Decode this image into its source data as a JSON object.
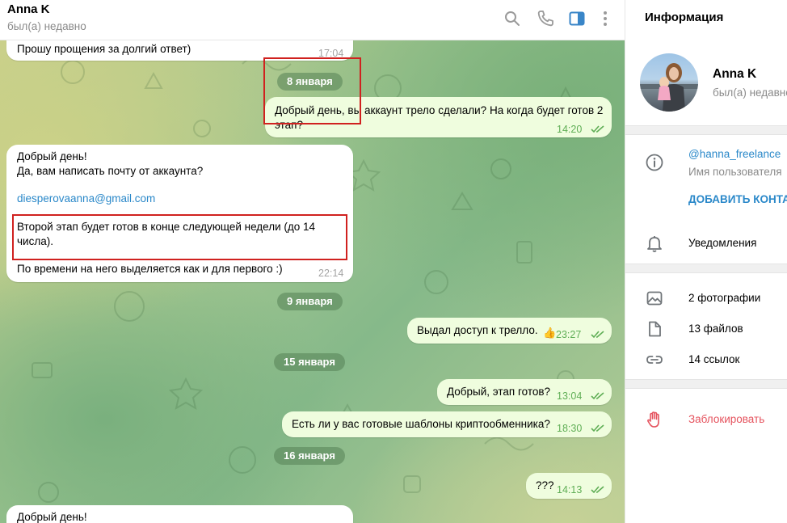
{
  "chat": {
    "title": "Anna K",
    "status": "был(а) недавно",
    "messages": {
      "m0": {
        "text": "Прошу прощения за долгий ответ)",
        "time": "17:04"
      },
      "m1": {
        "text1": "Добрый день, вы аккаунт трело сделали? На когда будет готов 2",
        "text2": "этап?",
        "time": "14:20"
      },
      "m2": {
        "line1": "Добрый день!",
        "line2": "Да, вам написать почту от аккаунта?",
        "email": "diesperovaanna@gmail.com",
        "line3": "Второй этап будет готов в конце следующей недели (до 14",
        "line4": "числа).",
        "line5": "По времени на него выделяется как и для первого :)",
        "time": "22:14"
      },
      "m3": {
        "text": "Выдал доступ к трелло.",
        "emoji": "👍",
        "time": "23:27"
      },
      "m4": {
        "text": "Добрый, этап готов?",
        "time": "13:04"
      },
      "m5": {
        "text": "Есть ли у вас готовые шаблоны криптообменника?",
        "time": "18:30"
      },
      "m6": {
        "text": "???",
        "time": "14:13"
      },
      "m7": {
        "text": "Добрый день!"
      }
    },
    "dates": {
      "d1": "8 января",
      "d2": "9 января",
      "d3": "15 января",
      "d4": "16 января"
    },
    "icons": {
      "search": "search-icon",
      "call": "phone-icon",
      "sidebar": "sidebar-toggle-icon",
      "more": "more-vertical-icon"
    }
  },
  "info": {
    "title": "Информация",
    "name": "Anna K",
    "status": "был(а) недавно",
    "username": "@hanna_freelance",
    "username_label": "Имя пользователя",
    "add_contact": "ДОБАВИТЬ КОНТАКТ",
    "notifications": "Уведомления",
    "photos": "2 фотографии",
    "files": "13 файлов",
    "links": "14 ссылок",
    "block": "Заблокировать"
  },
  "colors": {
    "accent": "#2a88c9",
    "outgoing": "#effdde",
    "block": "#e5535e",
    "annotation": "#d0211f",
    "active_icon": "#3a86c8"
  }
}
